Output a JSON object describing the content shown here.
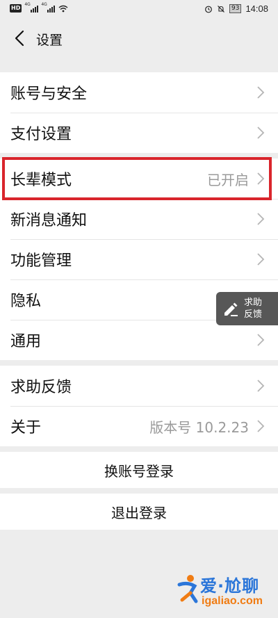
{
  "status_bar": {
    "hd_label": "HD",
    "sig1_label": "4G",
    "sig2_label": "4G",
    "battery": "93",
    "time": "14:08"
  },
  "nav": {
    "title": "设置"
  },
  "settings_group_1": [
    {
      "label": "账号与安全",
      "value": ""
    },
    {
      "label": "支付设置",
      "value": ""
    }
  ],
  "settings_group_2": [
    {
      "label": "长辈模式",
      "value": "已开启"
    },
    {
      "label": "新消息通知",
      "value": ""
    },
    {
      "label": "功能管理",
      "value": ""
    },
    {
      "label": "隐私",
      "value": ""
    },
    {
      "label": "通用",
      "value": ""
    }
  ],
  "settings_group_3": [
    {
      "label": "求助反馈",
      "value": ""
    },
    {
      "label": "关于",
      "value": "版本号 10.2.23"
    }
  ],
  "float_help": {
    "line1": "求助",
    "line2": "反馈"
  },
  "actions": {
    "switch_account": "换账号登录",
    "logout": "退出登录"
  },
  "watermark": {
    "cn": "爱·尬聊",
    "en": "igaliao.com"
  },
  "colors": {
    "highlight": "#d9252c",
    "watermark_blue": "#2b76d9",
    "watermark_orange": "#f07c13"
  }
}
